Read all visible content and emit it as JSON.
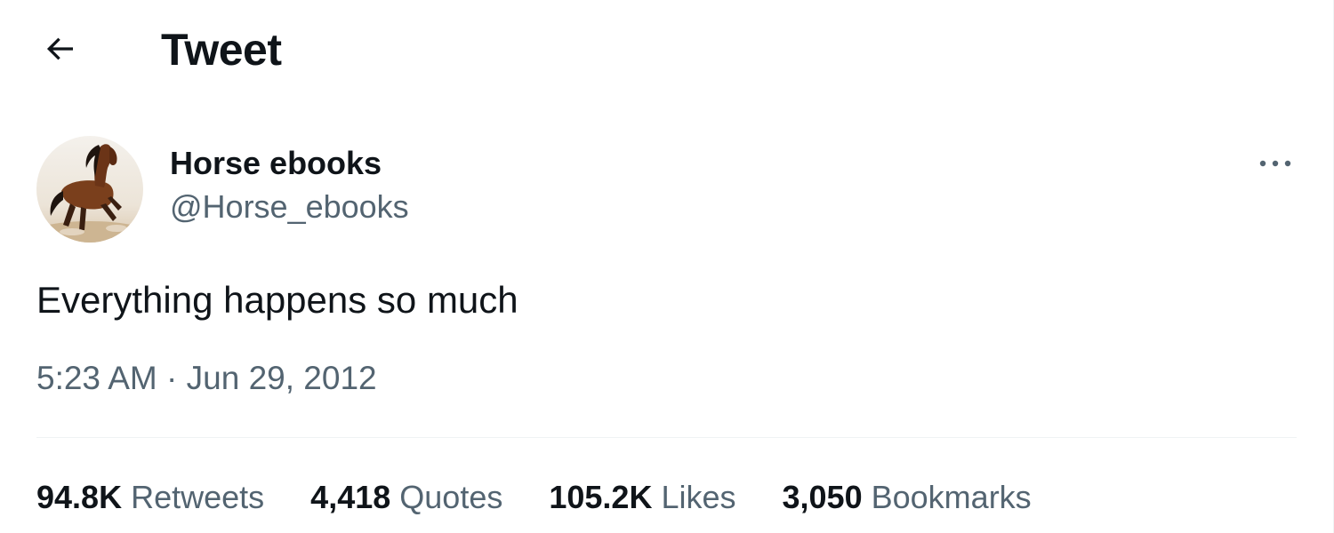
{
  "header": {
    "back_icon": "arrow-left-icon",
    "title": "Tweet"
  },
  "tweet": {
    "author": {
      "display_name": "Horse ebooks",
      "handle": "@Horse_ebooks",
      "avatar": "running-horse-photo"
    },
    "more_icon": "more-horizontal-icon",
    "text": "Everything happens so much",
    "time": "5:23 AM",
    "separator": "·",
    "date": "Jun 29, 2012"
  },
  "stats": [
    {
      "count": "94.8K",
      "label": "Retweets"
    },
    {
      "count": "4,418",
      "label": "Quotes"
    },
    {
      "count": "105.2K",
      "label": "Likes"
    },
    {
      "count": "3,050",
      "label": "Bookmarks"
    }
  ],
  "colors": {
    "text_primary": "#0f1419",
    "text_secondary": "#536471",
    "divider": "#eff3f4"
  }
}
